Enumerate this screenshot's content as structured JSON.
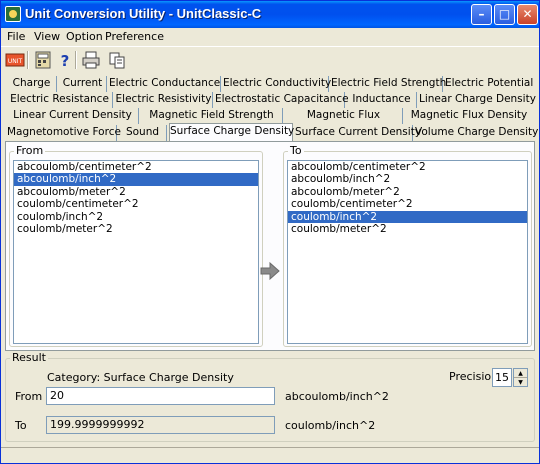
{
  "window": {
    "title": "Unit Conversion Utility - UnitClassic-C"
  },
  "menu": [
    "File",
    "View",
    "Option",
    "Preference"
  ],
  "toolbar": [
    "unit-logo-icon",
    "calculator-icon",
    "help-icon",
    "print-icon",
    "copy-icon"
  ],
  "tabs": {
    "row1": [
      "Charge",
      "Current",
      "Electric Conductance",
      "Electric Conductivity",
      "Electric Field Strength",
      "Electric Potential"
    ],
    "row2": [
      "Electric Resistance",
      "Electric Resistivity",
      "Electrostatic Capacitance",
      "Inductance",
      "Linear Charge Density"
    ],
    "row3": [
      "Linear Current Density",
      "Magnetic Field Strength",
      "Magnetic Flux",
      "Magnetic Flux Density"
    ],
    "row4": [
      "Magnetomotive Force",
      "Sound",
      "Surface Charge Density",
      "Surface Current Density",
      "Volume Charge Density"
    ],
    "active": "Surface Charge Density"
  },
  "from_panel": {
    "label": "From",
    "items": [
      "abcoulomb/centimeter^2",
      "abcoulomb/inch^2",
      "abcoulomb/meter^2",
      "coulomb/centimeter^2",
      "coulomb/inch^2",
      "coulomb/meter^2"
    ],
    "selected": "abcoulomb/inch^2"
  },
  "to_panel": {
    "label": "To",
    "items": [
      "abcoulomb/centimeter^2",
      "abcoulomb/inch^2",
      "abcoulomb/meter^2",
      "coulomb/centimeter^2",
      "coulomb/inch^2",
      "coulomb/meter^2"
    ],
    "selected": "coulomb/inch^2"
  },
  "result": {
    "label": "Result",
    "category": "Category: Surface Charge Density",
    "precision_label": "Precision",
    "precision": "15",
    "from_label": "From",
    "from_value": "20",
    "from_unit": "abcoulomb/inch^2",
    "to_label": "To",
    "to_value": "199.9999999992",
    "to_unit": "coulomb/inch^2"
  },
  "colors": {
    "titlebar": "#0054e3",
    "selection": "#316ac5",
    "face": "#ece9d8"
  }
}
